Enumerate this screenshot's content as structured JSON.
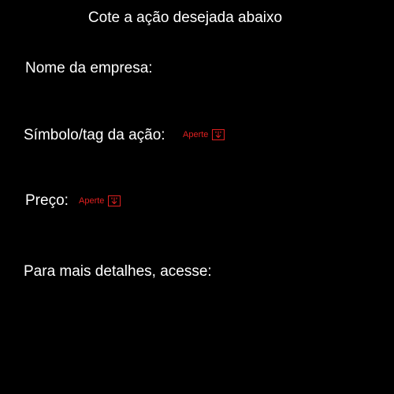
{
  "title": "Cote a ação desejada abaixo",
  "fields": {
    "company_label": "Nome da empresa:",
    "symbol_label": "Símbolo/tag da ação:",
    "price_label": "Preço:",
    "details_label": "Para mais detalhes, acesse:"
  },
  "buttons": {
    "symbol_press": "Aperte",
    "price_press": "Aperte"
  },
  "icons": {
    "press_icon": "download-arrow-icon"
  },
  "colors": {
    "background": "#000000",
    "text": "#ffffff",
    "accent": "#e02020"
  }
}
